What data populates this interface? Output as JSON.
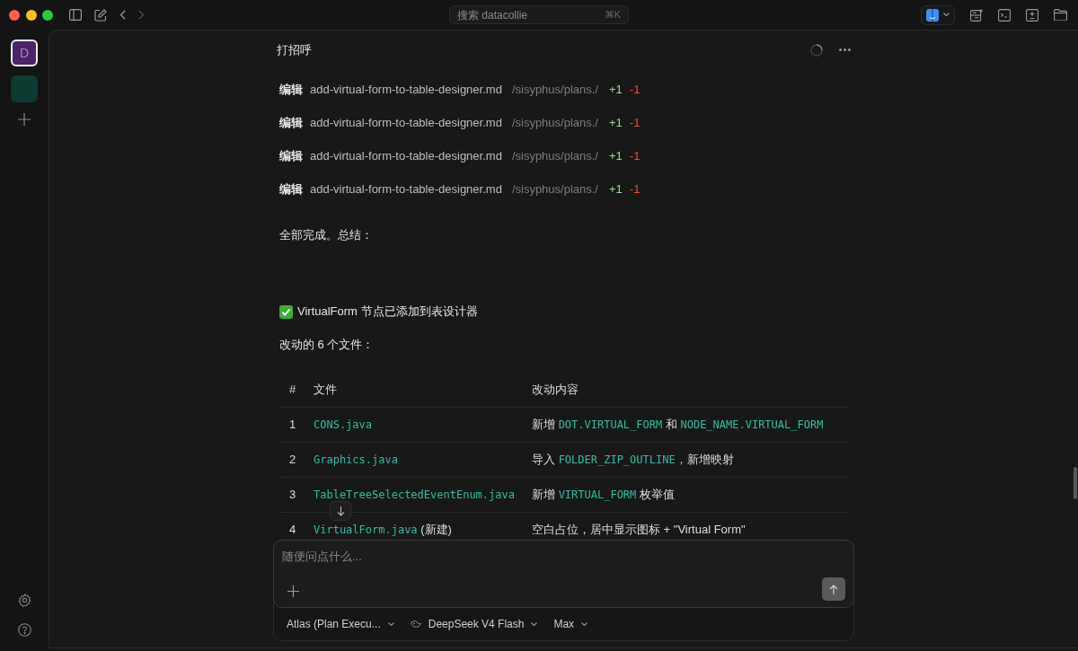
{
  "titlebar": {
    "search": {
      "placeholder": "搜索 datacollie",
      "shortcut": "⌘K"
    }
  },
  "rail": {
    "workspaces": [
      {
        "label": "D",
        "selected": true,
        "color": "#4b2468"
      },
      {
        "selected": false,
        "color": "#0c3b32"
      }
    ]
  },
  "chat": {
    "title": "打招呼",
    "edits": [
      {
        "action": "编辑",
        "file": "add-virtual-form-to-table-designer.md",
        "path": "/sisyphus/plans./",
        "added": "+1",
        "removed": "-1"
      },
      {
        "action": "编辑",
        "file": "add-virtual-form-to-table-designer.md",
        "path": "/sisyphus/plans./",
        "added": "+1",
        "removed": "-1"
      },
      {
        "action": "编辑",
        "file": "add-virtual-form-to-table-designer.md",
        "path": "/sisyphus/plans./",
        "added": "+1",
        "removed": "-1"
      },
      {
        "action": "编辑",
        "file": "add-virtual-form-to-table-designer.md",
        "path": "/sisyphus/plans./",
        "added": "+1",
        "removed": "-1"
      }
    ],
    "summary": "全部完成。总结：",
    "heading": "VirtualForm 节点已添加到表设计器",
    "subheading": "改动的 6 个文件：",
    "table": {
      "columns": [
        "#",
        "文件",
        "改动内容"
      ],
      "rows": [
        {
          "num": "1",
          "file": [
            {
              "text": "CONS.java",
              "code": true
            }
          ],
          "change": [
            {
              "text": "新增 ",
              "code": false
            },
            {
              "text": "DOT.VIRTUAL_FORM",
              "code": true
            },
            {
              "text": " 和 ",
              "code": false
            },
            {
              "text": "NODE_NAME.VIRTUAL_FORM",
              "code": true
            }
          ]
        },
        {
          "num": "2",
          "file": [
            {
              "text": "Graphics.java",
              "code": true
            }
          ],
          "change": [
            {
              "text": "导入 ",
              "code": false
            },
            {
              "text": "FOLDER_ZIP_OUTLINE",
              "code": true
            },
            {
              "text": "，新增映射",
              "code": false
            }
          ]
        },
        {
          "num": "3",
          "file": [
            {
              "text": "TableTreeSelectedEventEnum.java",
              "code": true
            }
          ],
          "change": [
            {
              "text": "新增 ",
              "code": false
            },
            {
              "text": "VIRTUAL_FORM",
              "code": true
            },
            {
              "text": " 枚举值",
              "code": false
            }
          ]
        },
        {
          "num": "4",
          "file": [
            {
              "text": "VirtualForm.java",
              "code": true
            },
            {
              "text": " (新建)",
              "code": false
            }
          ],
          "change": [
            {
              "text": "空白占位，居中显示图标 + \"Virtual Form\"",
              "code": false
            }
          ]
        }
      ]
    }
  },
  "composer": {
    "placeholder": "随便问点什么...",
    "selectors": [
      {
        "kind": "agent",
        "label": "Atlas (Plan Execu..."
      },
      {
        "kind": "model",
        "label": "DeepSeek V4 Flash"
      },
      {
        "kind": "effort",
        "label": "Max"
      }
    ]
  }
}
